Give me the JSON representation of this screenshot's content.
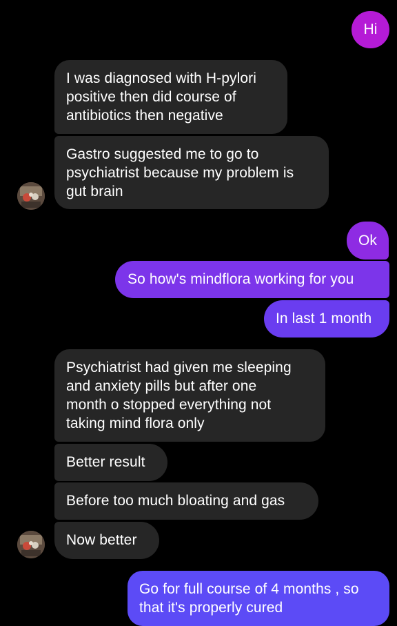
{
  "colors": {
    "background": "#000000",
    "incoming_bubble": "#262626",
    "hi_bubble": "#b51bd6",
    "ok_bubble": "#8e2be3",
    "mindflora_bubble": "#7c35ea",
    "last_month_bubble": "#6a3df0",
    "full_course_bubble": "#5c4bf6",
    "text": "#ffffff"
  },
  "avatar_icon": "user-avatar-photo",
  "messages": {
    "hi": "Hi",
    "h_pylori": "I was diagnosed with H-pylori\npositive then did course of\nantibiotics then negative",
    "gastro": "Gastro suggested me to go to\npsychiatrist because my problem is\ngut brain",
    "ok": "Ok",
    "mindflora_question": "So how's mindflora working for you",
    "last_month": "In last 1 month",
    "psychiatrist": "Psychiatrist had given me sleeping\nand anxiety pills but after one\nmonth o stopped everything not\ntaking mind flora only",
    "better_result": "Better result",
    "bloating": "Before too much bloating and gas",
    "now_better": "Now better",
    "full_course": "Go for full course of 4 months , so\nthat it's properly cured"
  }
}
